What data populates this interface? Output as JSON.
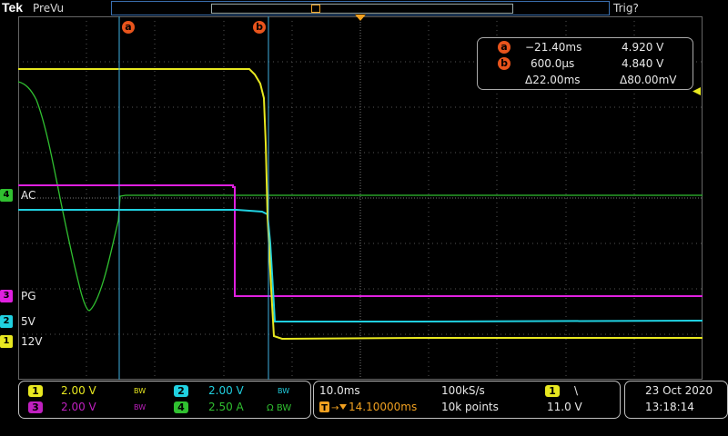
{
  "topbar": {
    "brand": "Tek",
    "acq_state": "PreVu",
    "trigger_status": "Trig?"
  },
  "cursors": {
    "a": {
      "label": "a",
      "time": "−21.40ms",
      "value": "4.920 V"
    },
    "b": {
      "label": "b",
      "time": "600.0µs",
      "value": "4.840 V"
    },
    "delta_time": "Δ22.00ms",
    "delta_value": "Δ80.00mV"
  },
  "channels": [
    {
      "num": "4",
      "name": "AC",
      "color": "#30c030"
    },
    {
      "num": "3",
      "name": "PG",
      "color": "#e020e0"
    },
    {
      "num": "2",
      "name": "5V",
      "color": "#20d0e0"
    },
    {
      "num": "1",
      "name": "12V",
      "color": "#e8e820"
    }
  ],
  "vertical": {
    "ch1": {
      "num": "1",
      "scale": "2.00 V",
      "bw": "BW"
    },
    "ch2": {
      "num": "2",
      "scale": "2.00 V",
      "bw": "BW"
    },
    "ch3": {
      "num": "3",
      "scale": "2.00 V",
      "bw": "BW"
    },
    "ch4": {
      "num": "4",
      "scale": "2.50 A",
      "coupling": "Ω BW"
    }
  },
  "horizontal": {
    "timebase": "10.0ms",
    "sample_rate": "100kS/s",
    "delay": "14.10000ms",
    "record_length": "10k points"
  },
  "trigger": {
    "source": "1",
    "slope": "\\",
    "level": "11.0 V"
  },
  "datetime": {
    "date": "23 Oct  2020",
    "time": "13:18:14"
  },
  "colors": {
    "ch1": "#e8e820",
    "ch2": "#20d0e0",
    "ch3": "#e020e0",
    "ch4": "#30c030",
    "cursor": "#40b0e0",
    "cursor_badge": "#e8541c",
    "trigger_marker": "#f0a020"
  }
}
